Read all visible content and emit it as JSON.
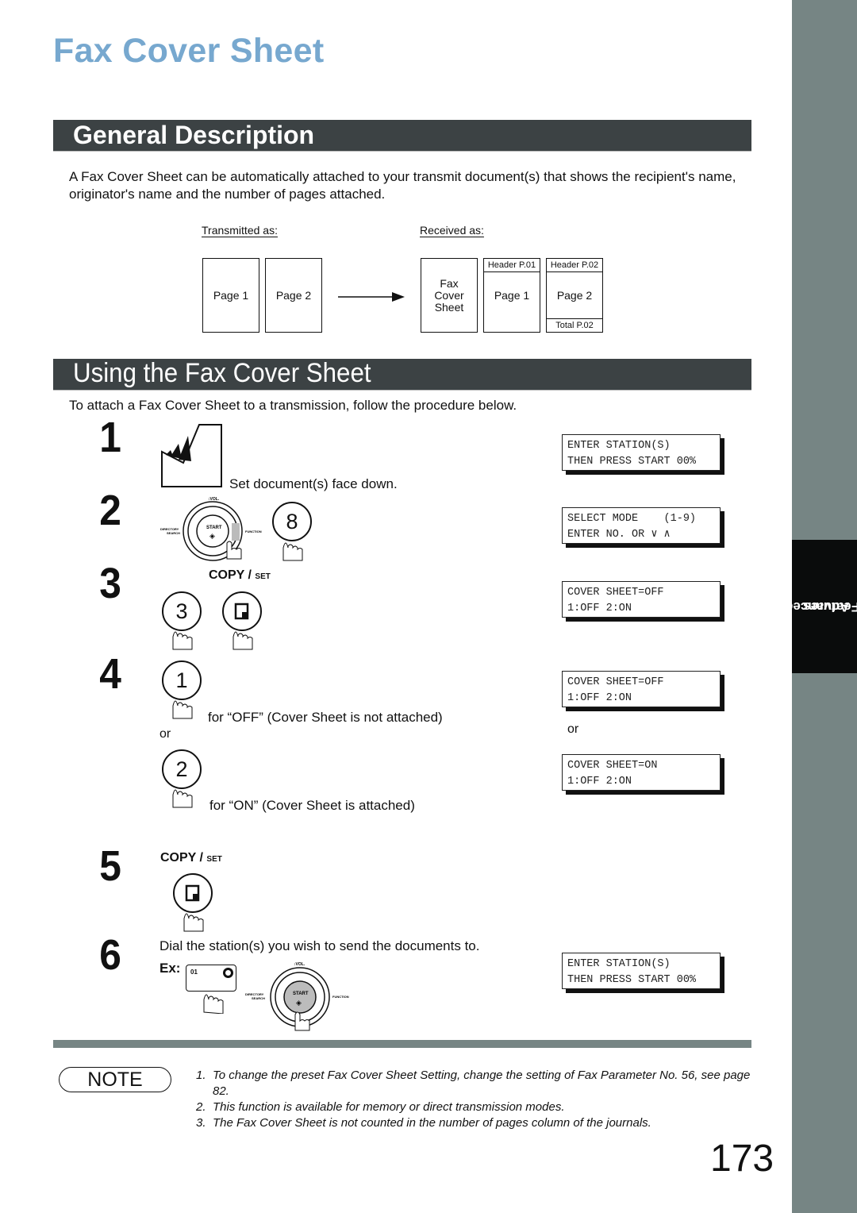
{
  "page_title": "Fax Cover Sheet",
  "side_tab": {
    "line1": "Advanced",
    "line2": "Features"
  },
  "sections": {
    "general": {
      "heading": "General Description",
      "description": "A Fax Cover Sheet  can be automatically attached to your transmit document(s) that shows the recipient's name, originator's name and the number of pages attached.",
      "diagram": {
        "transmitted_label": "Transmitted as:",
        "received_label": "Received as:",
        "transmitted_pages": [
          "Page 1",
          "Page 2"
        ],
        "received_pages": [
          {
            "header": "",
            "body": "Fax\nCover\nSheet",
            "footer": ""
          },
          {
            "header": "Header P.01",
            "body": "Page 1",
            "footer": ""
          },
          {
            "header": "Header P.02",
            "body": "Page 2",
            "footer": "Total P.02"
          }
        ]
      }
    },
    "using": {
      "heading": "Using the Fax Cover Sheet",
      "intro": "To attach a Fax Cover Sheet to a transmission, follow the procedure below."
    }
  },
  "steps": [
    {
      "number": "1",
      "text": "Set document(s) face down.",
      "lcd": [
        "ENTER STATION(S)",
        "THEN PRESS START 00%"
      ]
    },
    {
      "number": "2",
      "key": "8",
      "panel": {
        "vol": "↕VOL.",
        "start": "START",
        "left": "DIRECTORY SEARCH",
        "right": "FUNCTION"
      },
      "lcd": [
        "SELECT MODE    (1-9)",
        "ENTER NO. OR ∨ ∧"
      ]
    },
    {
      "number": "3",
      "copy_label": "COPY",
      "set_label": "SET",
      "key": "3",
      "lcd": [
        "COVER SHEET=OFF",
        "1:OFF 2:ON"
      ]
    },
    {
      "number": "4",
      "option_off": {
        "key": "1",
        "text": "for “OFF” (Cover Sheet is not attached)",
        "lcd": [
          "COVER SHEET=OFF",
          "1:OFF 2:ON"
        ]
      },
      "or_label": "or",
      "option_on": {
        "key": "2",
        "text": "for “ON” (Cover Sheet is attached)",
        "lcd": [
          "COVER SHEET=ON",
          "1:OFF 2:ON"
        ]
      }
    },
    {
      "number": "5",
      "copy_label": "COPY",
      "set_label": "SET"
    },
    {
      "number": "6",
      "text": "Dial the station(s) you wish to send the documents to.",
      "ex_label": "Ex:",
      "one_touch": "01",
      "panel": {
        "vol": "↕VOL.",
        "start": "START",
        "left": "DIRECTORY SEARCH",
        "right": "FUNCTION"
      },
      "lcd": [
        "ENTER STATION(S)",
        "THEN PRESS START 00%"
      ]
    }
  ],
  "note": {
    "label": "NOTE",
    "items": [
      {
        "n": "1.",
        "text": "To change the preset Fax Cover Sheet Setting, change the setting of Fax Parameter No. 56, see page 82."
      },
      {
        "n": "2.",
        "text": "This function is available for memory or direct transmission modes."
      },
      {
        "n": "3.",
        "text": "The Fax Cover Sheet is not counted in the number of pages column of the journals."
      }
    ]
  },
  "page_number": "173",
  "colors": {
    "title": "#77a8cf",
    "section_bar": "#3c4244",
    "side_strip": "#768584",
    "side_tab": "#0a0c0c"
  }
}
